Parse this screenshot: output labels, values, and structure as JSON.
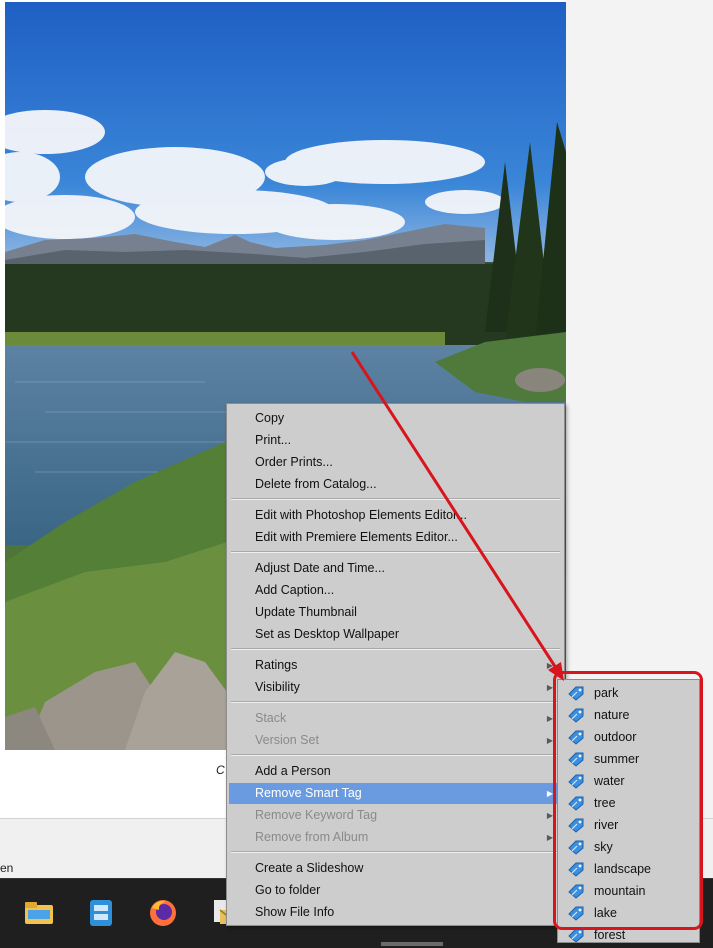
{
  "caption_fragment": "C",
  "window_fragment_text": "en",
  "context_menu": {
    "groups": [
      [
        {
          "label": "Copy",
          "enabled": true,
          "submenu": false
        },
        {
          "label": "Print...",
          "enabled": true,
          "submenu": false
        },
        {
          "label": "Order Prints...",
          "enabled": true,
          "submenu": false
        },
        {
          "label": "Delete from Catalog...",
          "enabled": true,
          "submenu": false
        }
      ],
      [
        {
          "label": "Edit with Photoshop Elements Editor...",
          "enabled": true,
          "submenu": false
        },
        {
          "label": "Edit with Premiere Elements Editor...",
          "enabled": true,
          "submenu": false
        }
      ],
      [
        {
          "label": "Adjust Date and Time...",
          "enabled": true,
          "submenu": false
        },
        {
          "label": "Add Caption...",
          "enabled": true,
          "submenu": false
        },
        {
          "label": "Update Thumbnail",
          "enabled": true,
          "submenu": false
        },
        {
          "label": "Set as Desktop Wallpaper",
          "enabled": true,
          "submenu": false
        }
      ],
      [
        {
          "label": "Ratings",
          "enabled": true,
          "submenu": true
        },
        {
          "label": "Visibility",
          "enabled": true,
          "submenu": true
        }
      ],
      [
        {
          "label": "Stack",
          "enabled": false,
          "submenu": true
        },
        {
          "label": "Version Set",
          "enabled": false,
          "submenu": true
        }
      ],
      [
        {
          "label": "Add a Person",
          "enabled": true,
          "submenu": false
        },
        {
          "label": "Remove Smart Tag",
          "enabled": true,
          "submenu": true,
          "highlighted": true
        },
        {
          "label": "Remove Keyword Tag",
          "enabled": false,
          "submenu": true
        },
        {
          "label": "Remove from Album",
          "enabled": false,
          "submenu": true
        }
      ],
      [
        {
          "label": "Create a Slideshow",
          "enabled": true,
          "submenu": false
        },
        {
          "label": "Go to folder",
          "enabled": true,
          "submenu": false
        },
        {
          "label": "Show File Info",
          "enabled": true,
          "submenu": false
        }
      ]
    ]
  },
  "smart_tag_submenu": {
    "icon": "smart-tag-icon",
    "items": [
      "park",
      "nature",
      "outdoor",
      "summer",
      "water",
      "tree",
      "river",
      "sky",
      "landscape",
      "mountain",
      "lake",
      "forest"
    ]
  },
  "taskbar": {
    "icons": [
      "file-explorer-icon",
      "app-icon",
      "firefox-icon",
      "mail-icon",
      "pen-app-icon",
      "premiere-icon",
      "elements-icon",
      "network-icon",
      "editor-icon"
    ]
  },
  "colors": {
    "menu_bg": "#cdcdcd",
    "menu_highlight": "#6a9be0",
    "annotation_red": "#d8141c",
    "taskbar_bg": "#1f1f1f"
  }
}
